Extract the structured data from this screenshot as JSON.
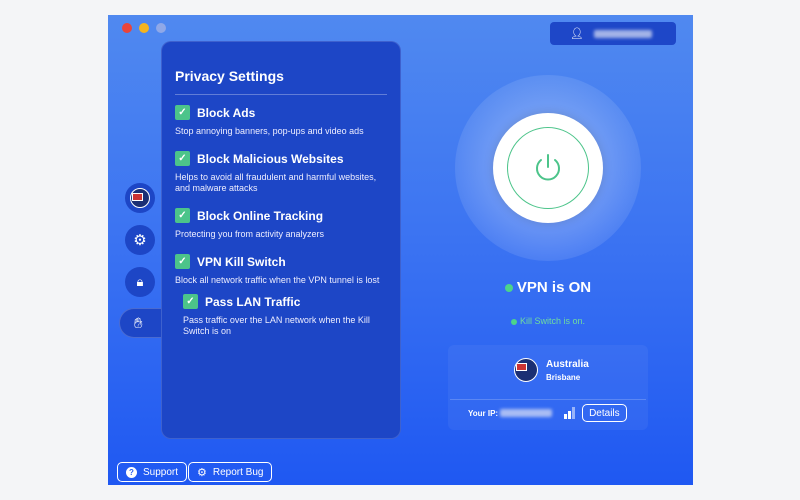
{
  "window": {
    "traffic_lights": [
      "#e9443b",
      "#f5b41f",
      "#8fa8e8"
    ]
  },
  "user": {
    "icon": "user-icon"
  },
  "panel": {
    "title": "Privacy Settings",
    "options": [
      {
        "label": "Block Ads",
        "desc": "Stop annoying banners, pop-ups and video ads",
        "checked": true
      },
      {
        "label": "Block Malicious Websites",
        "desc": "Helps to avoid all fraudulent and harmful websites, and malware attacks",
        "checked": true
      },
      {
        "label": "Block Online Tracking",
        "desc": "Protecting you from activity analyzers",
        "checked": true
      },
      {
        "label": "VPN Kill Switch",
        "desc": "Block all network traffic when the VPN tunnel is lost",
        "checked": true
      },
      {
        "label": "Pass LAN Traffic",
        "desc": "Pass traffic over the LAN network when the Kill Switch is on",
        "checked": true
      }
    ]
  },
  "status": {
    "vpn": "VPN is ON",
    "kill_switch": "Kill Switch is on."
  },
  "location": {
    "country": "Australia",
    "city": "Brisbane",
    "ip_label": "Your IP:",
    "details": "Details"
  },
  "footer": {
    "support": "Support",
    "report": "Report Bug"
  },
  "colors": {
    "accent": "#4cc48a",
    "panel": "#1d46c6"
  }
}
